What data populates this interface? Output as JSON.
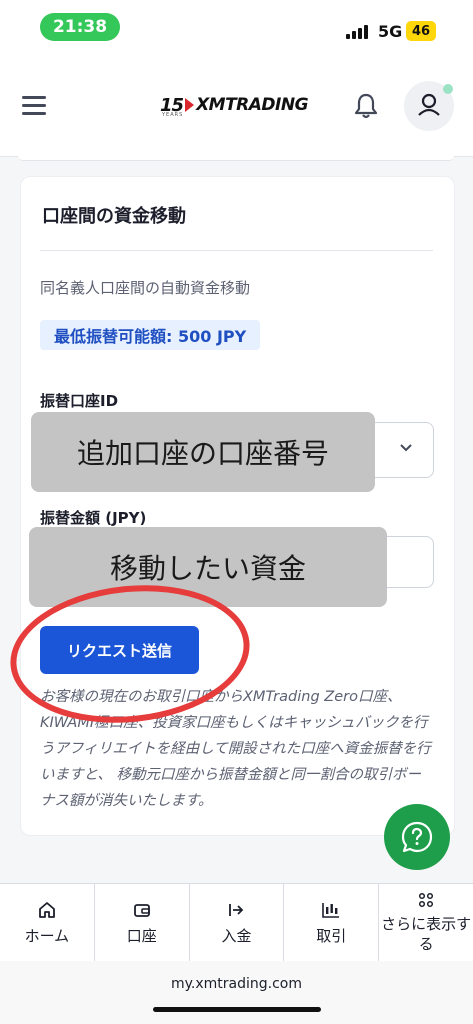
{
  "status_bar": {
    "time": "21:38",
    "network": "5G",
    "battery": "46"
  },
  "header": {
    "logo_number": "15",
    "logo_text": "XMTRADING",
    "logo_years": "YEARS"
  },
  "card": {
    "title": "口座間の資金移動",
    "subtitle": "同名義人口座間の自動資金移動",
    "min_transfer": "最低振替可能額: 500 JPY",
    "account_label": "振替口座ID",
    "account_overlay": "追加口座の口座番号",
    "amount_label": "振替金額 (JPY)",
    "amount_overlay": "移動したい資金",
    "submit_label": "リクエスト送信",
    "notice": "お客様の現在のお取引口座からXMTrading Zero口座、KIWAMI極口座、投資家口座もしくはキャッシュバックを行うアフィリエイトを経由して開設された口座へ資金振替を行いますと、 移動元口座から振替金額と同一割合の取引ボーナス額が消失いたします。"
  },
  "bottom_nav": {
    "items": [
      {
        "label": "ホーム",
        "icon": "home-icon"
      },
      {
        "label": "口座",
        "icon": "wallet-icon"
      },
      {
        "label": "入金",
        "icon": "deposit-arrow-icon"
      },
      {
        "label": "取引",
        "icon": "candlestick-icon"
      },
      {
        "label": "さらに表示する",
        "icon": "grid-icon"
      }
    ]
  },
  "browser": {
    "url": "my.xmtrading.com"
  },
  "colors": {
    "accent": "#1c56d8",
    "badge_bg": "#e7f0fe",
    "help_fab": "#1e9e4a",
    "annotation_ring": "#e73c3c",
    "overlay_gray": "#c4c4c4"
  }
}
